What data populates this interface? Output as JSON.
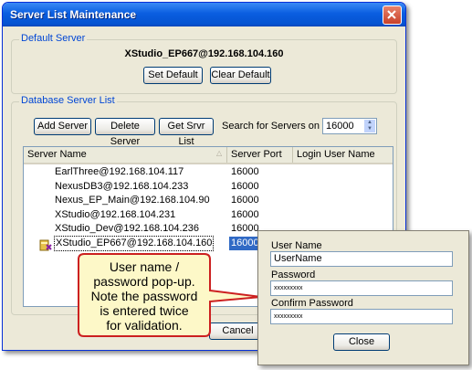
{
  "window": {
    "title": "Server List Maintenance"
  },
  "default_server": {
    "group_label": "Default Server",
    "server": "XStudio_EP667@192.168.104.160",
    "set_default_label": "Set Default",
    "clear_default_label": "Clear Default"
  },
  "database_list": {
    "group_label": "Database Server List",
    "add_label": "Add Server",
    "delete_label": "Delete Server",
    "get_label": "Get Srvr List",
    "search_label": "Search for Servers on Port:",
    "port_value": "16000",
    "columns": [
      "Server Name",
      "Server Port",
      "Login User Name"
    ],
    "rows": [
      {
        "name": "EarlThree@192.168.104.117",
        "port": "16000"
      },
      {
        "name": "NexusDB3@192.168.104.233",
        "port": "16000"
      },
      {
        "name": "Nexus_EP_Main@192.168.104.90",
        "port": "16000"
      },
      {
        "name": "XStudio@192.168.104.231",
        "port": "16000"
      },
      {
        "name": "XStudio_Dev@192.168.104.236",
        "port": "16000"
      },
      {
        "name": "XStudio_EP667@192.168.104.160",
        "port": "16000",
        "selected": true
      }
    ]
  },
  "footer": {
    "cancel_label": "Cancel"
  },
  "popup": {
    "user_label": "User Name",
    "user_value": "UserName",
    "password_label": "Password",
    "password_value": "xxxxxxxxx",
    "confirm_label": "Confirm Password",
    "confirm_value": "xxxxxxxxx",
    "close_label": "Close"
  },
  "callout": {
    "lines": [
      "User name /",
      "password pop-up.",
      "Note the password",
      "is entered twice",
      "for validation."
    ]
  },
  "colors": {
    "accent": "#0046d5",
    "callout_fill": "#fdf8c8",
    "callout_border": "#cc2020",
    "selection": "#316ac5"
  },
  "icons": {
    "close": "close-x-icon",
    "sort": "sort-triangle-icon",
    "default_server": "default-server-icon"
  }
}
